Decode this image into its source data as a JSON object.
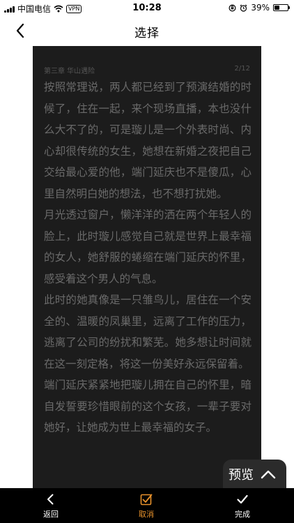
{
  "status_bar": {
    "carrier": "中国电信",
    "vpn": "VPN",
    "time": "10:28",
    "battery": "39%"
  },
  "nav": {
    "title": "选择"
  },
  "page": {
    "chapter": "第三章 华山遇险",
    "page_number": "2/12",
    "paragraphs": [
      "按照常理说，两人都已经到了预演结婚的时候了，住在一起，来个现场直播，本也没什么大不了的，可是璇儿是一个外表时尚、内心却很传统的女生，她想在新婚之夜把自己交给最心爱的他，端门延庆也不是傻瓜，心里自然明白她的想法，也不想打扰她。",
      "月光透过窗户，懒洋洋的洒在两个年轻人的脸上，此时璇儿感觉自己就是世界上最幸福的女人，她舒服的蜷缩在端门延庆的怀里，感受着这个男人的气息。",
      "此时的她真像是一只雏鸟儿，居住在一个安全的、温暖的凤巢里，远离了工作的压力，逃离了公司的纷扰和繁芜。她多想让时间就在这一刻定格，将这一份美好永远保留着。",
      "端门延庆紧紧地把璇儿拥在自己的怀里，暗自发誓要珍惜眼前的这个女孩，一辈子要对她好，让她成为世上最幸福的女子。"
    ]
  },
  "preview": {
    "label": "预览"
  },
  "toolbar": {
    "back_label": "返回",
    "cancel_label": "取消",
    "done_label": "完成"
  },
  "colors": {
    "page_background": "#1c1c1c",
    "page_text": "#6a6a6a",
    "toolbar_background": "#000000",
    "cancel_accent": "#e8922c"
  }
}
